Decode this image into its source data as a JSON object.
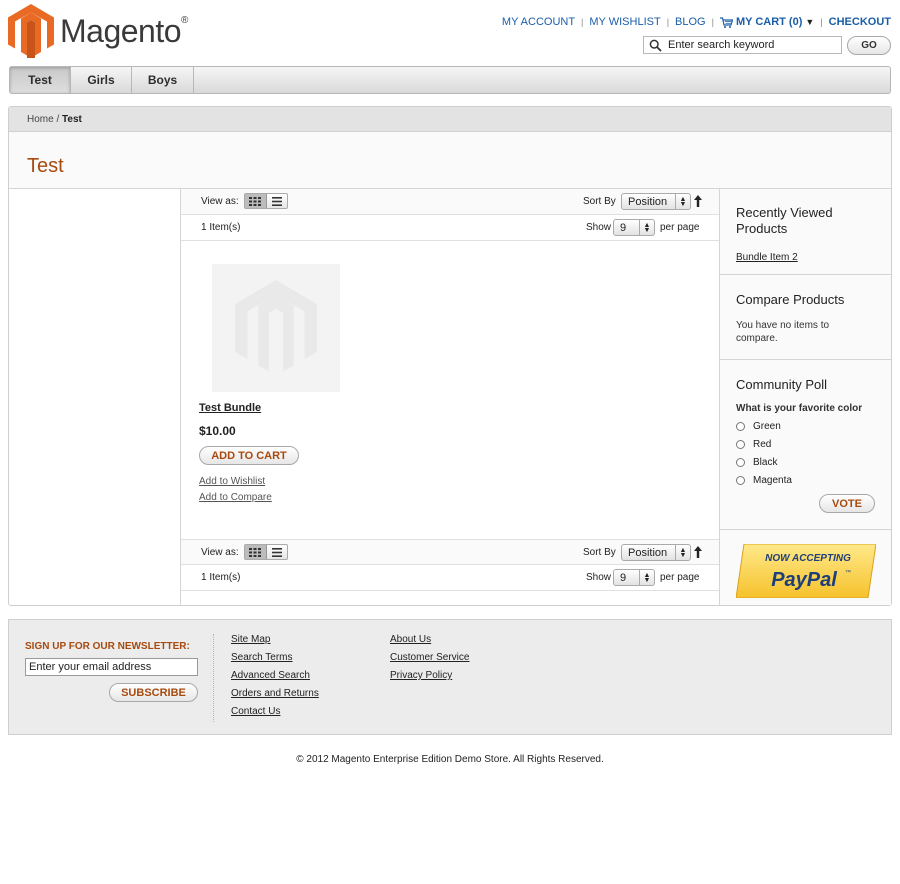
{
  "brand": {
    "name": "Magento",
    "registered_mark": "®",
    "orange": "#e96a25",
    "title_color": "#a74a0f",
    "link_blue": "#1a5ea8"
  },
  "quick_links": {
    "my_account": "MY ACCOUNT",
    "my_wishlist": "MY WISHLIST",
    "blog": "BLOG",
    "my_cart": "MY CART (0)",
    "cart_caret": "▼",
    "checkout": "CHECKOUT",
    "separator": "|"
  },
  "search": {
    "placeholder": "Enter search keyword",
    "go_label": "GO"
  },
  "nav": {
    "items": [
      {
        "label": "Test",
        "active": true
      },
      {
        "label": "Girls",
        "active": false
      },
      {
        "label": "Boys",
        "active": false
      }
    ]
  },
  "breadcrumb": {
    "home": "Home",
    "separator": " / ",
    "current": "Test"
  },
  "page": {
    "title": "Test"
  },
  "toolbar": {
    "view_as": "View as:",
    "sort_by": "Sort By",
    "sort_value": "Position",
    "item_count": "1 Item(s)",
    "show": "Show",
    "per_page_value": "9",
    "per_page": "per page"
  },
  "product": {
    "name": "Test Bundle",
    "price": "$10.00",
    "add_to_cart": "ADD TO CART",
    "add_to_wishlist": "Add to Wishlist",
    "add_to_compare": "Add to Compare"
  },
  "sidebar": {
    "recently_viewed": {
      "title": "Recently Viewed Products",
      "items": [
        "Bundle Item 2"
      ]
    },
    "compare": {
      "title": "Compare Products",
      "empty_text": "You have no items to compare."
    },
    "poll": {
      "title": "Community Poll",
      "question": "What is your favorite color",
      "options": [
        "Green",
        "Red",
        "Black",
        "Magenta"
      ],
      "vote_label": "VOTE"
    },
    "paypal": {
      "line1": "NOW ACCEPTING",
      "line2": "PayPal",
      "tm": "™"
    }
  },
  "footer": {
    "newsletter_title": "SIGN UP FOR OUR NEWSLETTER:",
    "email_placeholder": "Enter your email address",
    "subscribe_label": "SUBSCRIBE",
    "links_col1": [
      "Site Map",
      "Search Terms",
      "Advanced Search",
      "Orders and Returns",
      "Contact Us"
    ],
    "links_col2": [
      "About Us",
      "Customer Service",
      "Privacy Policy"
    ],
    "copyright": "© 2012 Magento Enterprise Edition Demo Store. All Rights Reserved."
  }
}
